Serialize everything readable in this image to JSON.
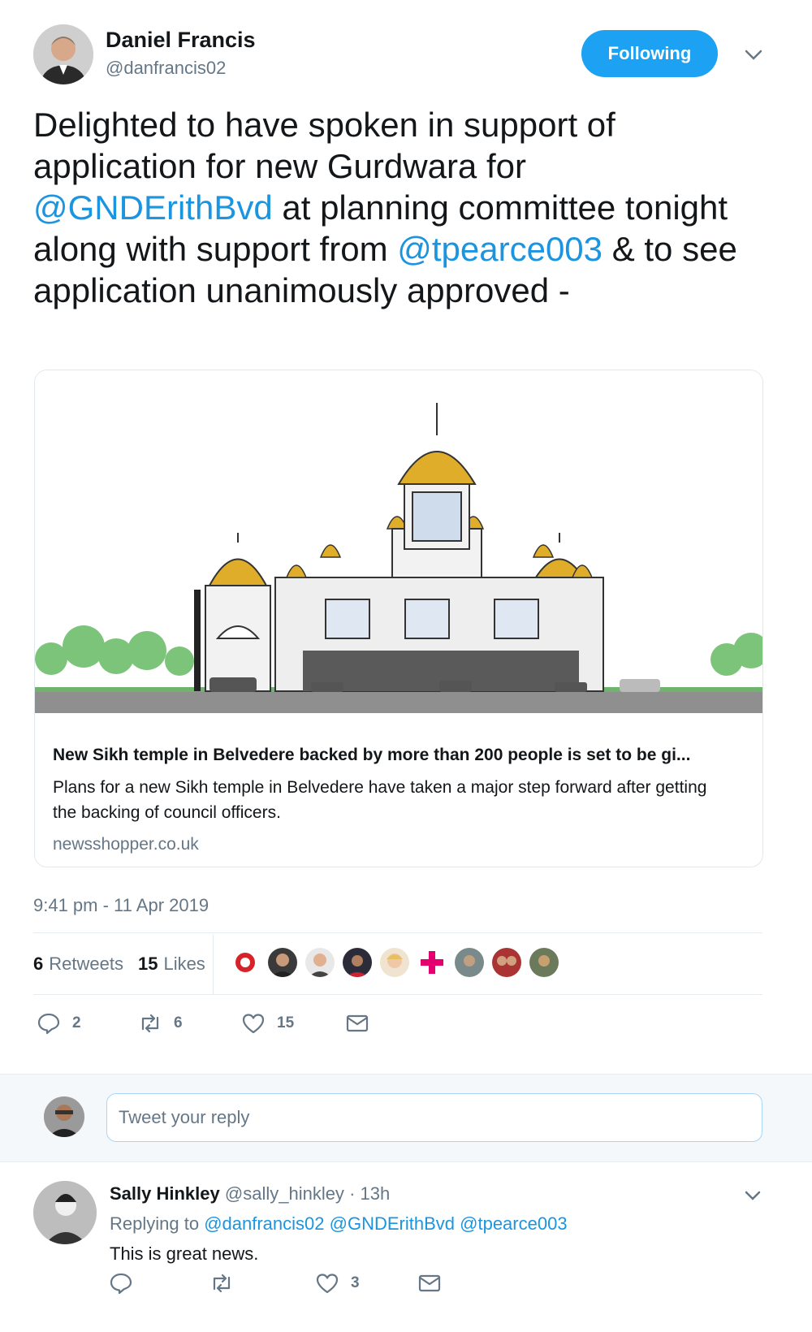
{
  "tweet": {
    "author": {
      "name": "Daniel Francis",
      "handle": "@danfrancis02"
    },
    "follow_button": "Following",
    "text": {
      "part1": "Delighted to have spoken in support of application for new Gurdwara for ",
      "mention1": "@GNDErithBvd",
      "part2": " at planning committee tonight along with support from ",
      "mention2": "@tpearce003",
      "part3": " & to see application unanimously approved -"
    },
    "card": {
      "title": "New Sikh temple in Belvedere backed by more than 200 people is set to be gi...",
      "description": "Plans for a new Sikh temple in Belvedere have taken a major step forward after getting the backing of council officers.",
      "domain": "newsshopper.co.uk"
    },
    "timestamp": "9:41 pm - 11 Apr 2019",
    "stats": {
      "retweets_count": "6",
      "retweets_label": "Retweets",
      "likes_count": "15",
      "likes_label": "Likes"
    },
    "actions": {
      "replies": "2",
      "retweets": "6",
      "likes": "15"
    }
  },
  "reply_box": {
    "placeholder": "Tweet your reply"
  },
  "reply": {
    "name": "Sally Hinkley",
    "handle": "@sally_hinkley",
    "time": "· 13h",
    "replying_label": "Replying to",
    "replying_to": [
      "@danfrancis02",
      "@GNDErithBvd",
      "@tpearce003"
    ],
    "text": "This is great news.",
    "actions": {
      "likes": "3"
    }
  },
  "colors": {
    "accent": "#1da1f2",
    "link": "#1b95e0",
    "muted": "#657786"
  },
  "icons": [
    "chevron-down-icon",
    "reply-icon",
    "retweet-icon",
    "heart-icon",
    "mail-icon"
  ]
}
